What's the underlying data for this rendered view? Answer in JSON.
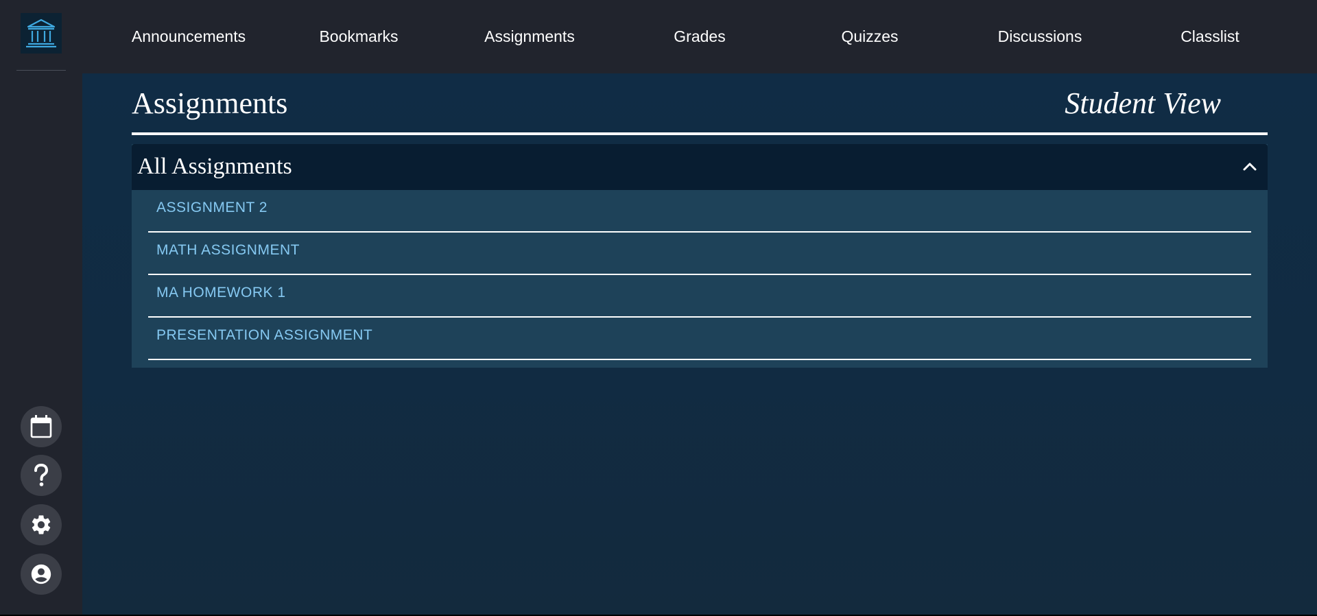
{
  "sidebar": {
    "logo_icon": "institution-icon",
    "buttons": [
      {
        "name": "calendar-button",
        "icon": "calendar-icon"
      },
      {
        "name": "help-button",
        "icon": "help-icon"
      },
      {
        "name": "settings-button",
        "icon": "gear-icon"
      },
      {
        "name": "profile-button",
        "icon": "account-circle-icon"
      }
    ]
  },
  "nav": {
    "items": [
      "Announcements",
      "Bookmarks",
      "Assignments",
      "Grades",
      "Quizzes",
      "Discussions",
      "Classlist"
    ]
  },
  "page": {
    "title": "Assignments",
    "view_label": "Student View"
  },
  "panel": {
    "title": "All Assignments",
    "expanded": true,
    "items": [
      "ASSIGNMENT 2",
      "MATH ASSIGNMENT",
      "MA HOMEWORK 1",
      "PRESENTATION ASSIGNMENT"
    ]
  },
  "colors": {
    "background": "#21242d",
    "main": "#102c45",
    "panel_header": "#081d31",
    "panel_body": "#1e4259",
    "link": "#86c9f2",
    "logo_accent": "#3fa9e0"
  }
}
